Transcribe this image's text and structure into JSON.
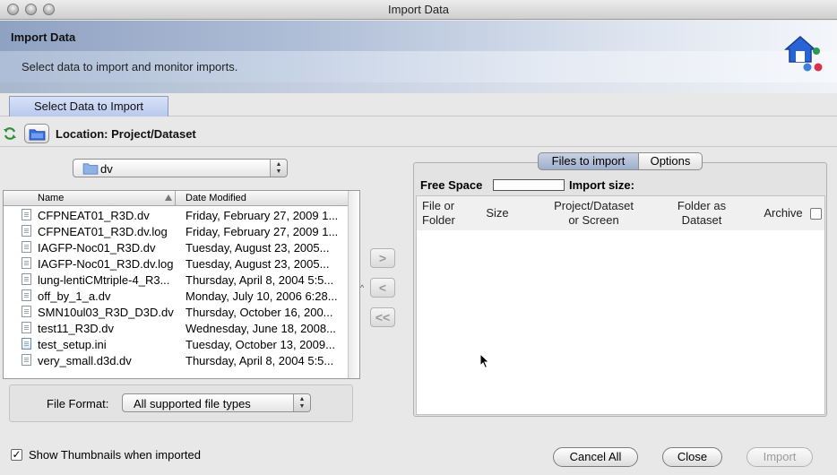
{
  "window": {
    "title": "Import Data"
  },
  "header": {
    "title": "Import Data",
    "subtitle": "Select data to import and monitor imports."
  },
  "tabs": [
    {
      "label": "Select Data to Import",
      "active": true
    }
  ],
  "location": {
    "label": "Location: Project/Dataset"
  },
  "folder_combo": {
    "value": "dv"
  },
  "file_table": {
    "columns": [
      "Name",
      "Date Modified"
    ],
    "rows": [
      {
        "name": "CFPNEAT01_R3D.dv",
        "date": "Friday, February 27, 2009 1...",
        "icon": "file-icon"
      },
      {
        "name": "CFPNEAT01_R3D.dv.log",
        "date": "Friday, February 27, 2009 1...",
        "icon": "file-icon"
      },
      {
        "name": "IAGFP-Noc01_R3D.dv",
        "date": "Tuesday, August 23, 2005...",
        "icon": "file-icon"
      },
      {
        "name": "IAGFP-Noc01_R3D.dv.log",
        "date": "Tuesday, August 23, 2005...",
        "icon": "file-icon"
      },
      {
        "name": "lung-lentiCMtriple-4_R3...",
        "date": "Thursday, April 8, 2004 5:5...",
        "icon": "file-icon"
      },
      {
        "name": "off_by_1_a.dv",
        "date": "Monday, July 10, 2006 6:28...",
        "icon": "file-icon"
      },
      {
        "name": "SMN10ul03_R3D_D3D.dv",
        "date": "Thursday, October 16, 200...",
        "icon": "file-icon"
      },
      {
        "name": "test11_R3D.dv",
        "date": "Wednesday, June 18, 2008...",
        "icon": "file-icon"
      },
      {
        "name": "test_setup.ini",
        "date": "Tuesday, October 13, 2009...",
        "icon": "ini-file-icon"
      },
      {
        "name": "very_small.d3d.dv",
        "date": "Thursday, April 8, 2004 5:5...",
        "icon": "file-icon"
      }
    ]
  },
  "file_format": {
    "label": "File Format:",
    "value": "All supported file types"
  },
  "transfer_buttons": {
    "add": ">",
    "remove": "<",
    "remove_all": "<<"
  },
  "right_panel": {
    "segments": [
      "Files to import",
      "Options"
    ],
    "free_space_label": "Free Space",
    "import_size_label": "Import size:",
    "columns": {
      "file_or_folder": [
        "File or",
        "Folder"
      ],
      "size": [
        "Size"
      ],
      "project_dataset": [
        "Project/Dataset",
        "or Screen"
      ],
      "folder_as_dataset": [
        "Folder as",
        "Dataset"
      ],
      "archive": [
        "Archive"
      ]
    }
  },
  "footer": {
    "show_thumbnails": {
      "label": "Show Thumbnails when imported",
      "checked": true
    },
    "cancel_all": "Cancel All",
    "close": "Close",
    "import": "Import"
  },
  "colors": {
    "tab_active": "#b9c9ee",
    "segment_active": "#9eaecb",
    "logo_blue": "#2a63d6",
    "logo_red": "#d8334a",
    "logo_green": "#2a9a55"
  }
}
